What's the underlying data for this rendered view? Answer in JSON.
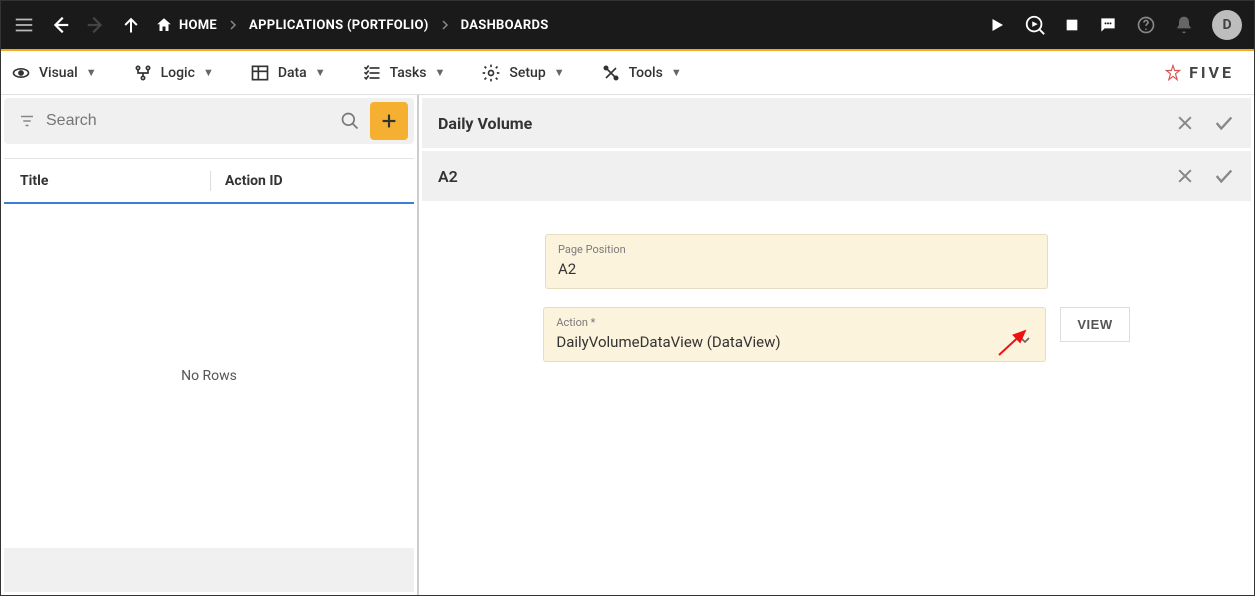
{
  "topbar": {
    "breadcrumb": {
      "home": "HOME",
      "applications": "APPLICATIONS (PORTFOLIO)",
      "dashboards": "DASHBOARDS"
    },
    "avatar_letter": "D"
  },
  "menubar": {
    "items": [
      {
        "label": "Visual"
      },
      {
        "label": "Logic"
      },
      {
        "label": "Data"
      },
      {
        "label": "Tasks"
      },
      {
        "label": "Setup"
      },
      {
        "label": "Tools"
      }
    ]
  },
  "brand": "FIVE",
  "left": {
    "search_placeholder": "Search",
    "columns": {
      "title": "Title",
      "action_id": "Action ID"
    },
    "empty_text": "No Rows"
  },
  "right": {
    "panel1_title": "Daily Volume",
    "panel2_title": "A2",
    "field_page_position": {
      "label": "Page Position",
      "value": "A2"
    },
    "field_action": {
      "label": "Action *",
      "value": "DailyVolumeDataView (DataView)"
    },
    "view_button": "VIEW"
  }
}
